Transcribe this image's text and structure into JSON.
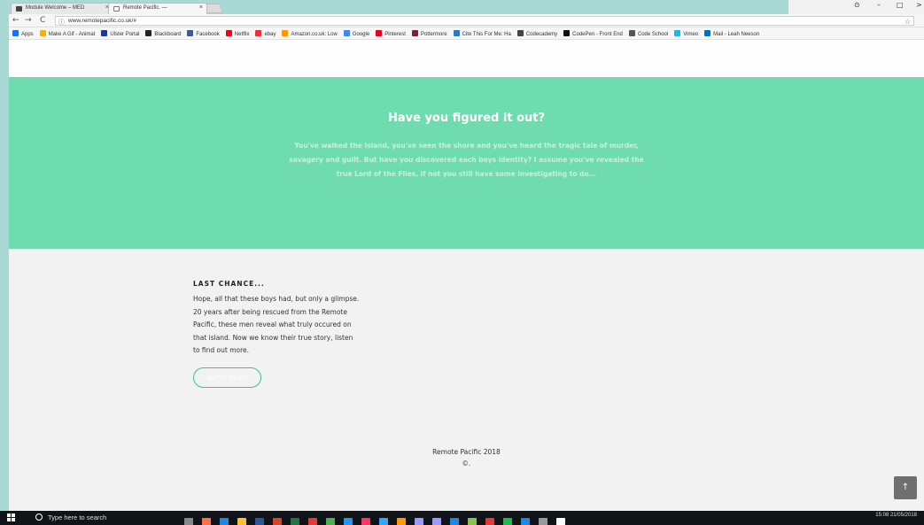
{
  "browser": {
    "tabs": [
      {
        "title": "Module Welcome – MED",
        "close": "×"
      },
      {
        "title": "Remote Pacific. —",
        "close": "×"
      }
    ],
    "window_controls": {
      "account": "⊙",
      "minimize": "–",
      "maximize": "□",
      "close": ">"
    },
    "nav": {
      "back": "←",
      "forward": "→",
      "reload": "C"
    },
    "address": {
      "info": "ⓘ",
      "url": "www.remotepacific.co.uk/#",
      "star": "☆"
    },
    "bookmarks": [
      {
        "label": "Apps",
        "color": "#1a73e8"
      },
      {
        "label": "Make A Gif - Animat",
        "color": "#f4b400"
      },
      {
        "label": "Ulster Portal",
        "color": "#1e3a8a"
      },
      {
        "label": "Blackboard",
        "color": "#222222"
      },
      {
        "label": "Facebook",
        "color": "#3b5998"
      },
      {
        "label": "Netflix",
        "color": "#e50914"
      },
      {
        "label": "ebay",
        "color": "#e53238"
      },
      {
        "label": "Amazon.co.uk: Low",
        "color": "#ff9900"
      },
      {
        "label": "Google",
        "color": "#4285f4"
      },
      {
        "label": "Pinterest",
        "color": "#e60023"
      },
      {
        "label": "Pottermore",
        "color": "#7a1f3d"
      },
      {
        "label": "Cite This For Me: Ha",
        "color": "#2b7bb9"
      },
      {
        "label": "Codecademy",
        "color": "#444444"
      },
      {
        "label": "CodePen - Front End",
        "color": "#111111"
      },
      {
        "label": "Code School",
        "color": "#555555"
      },
      {
        "label": "Vimeo",
        "color": "#1ab7ea"
      },
      {
        "label": "Mail - Leah Neeson",
        "color": "#0072c6"
      }
    ]
  },
  "page": {
    "hero": {
      "title": "Have you figured it out?",
      "body": "You've walked the island, you've seen the shore and you've heard the tragic tale of murder, savagery and guilt. But have you discovered each boys identity? I assume you've revealed the true Lord of the Flies, if not you still have some investigating to do..."
    },
    "last_chance": {
      "title": "LAST CHANCE...",
      "body": "Hope, all that these boys had, but only a glimpse. 20 years after being rescued from the Remote Pacific, these men reveal what truly occured on that island. Now we know their true story, listen to find out more.",
      "button": "WATCH VIDEO"
    },
    "footer": {
      "line1": "Remote Pacific 2018",
      "line2": "©."
    },
    "scroll_top": "↑"
  },
  "taskbar": {
    "search_placeholder": "Type here to search",
    "apps": [
      "#888888",
      "#ff7043",
      "#1e88e5",
      "#fbc02d",
      "#2b579a",
      "#d24726",
      "#217346",
      "#e53935",
      "#4caf50",
      "#2196f3",
      "#ff3366",
      "#31a8ff",
      "#ff9a00",
      "#9999ff",
      "#9999ff",
      "#1e88e5",
      "#8bc34a",
      "#e53935",
      "#1db954",
      "#1e88e5",
      "#999999",
      "#ffffff"
    ],
    "time": "15:08",
    "date": "21/05/2018"
  }
}
